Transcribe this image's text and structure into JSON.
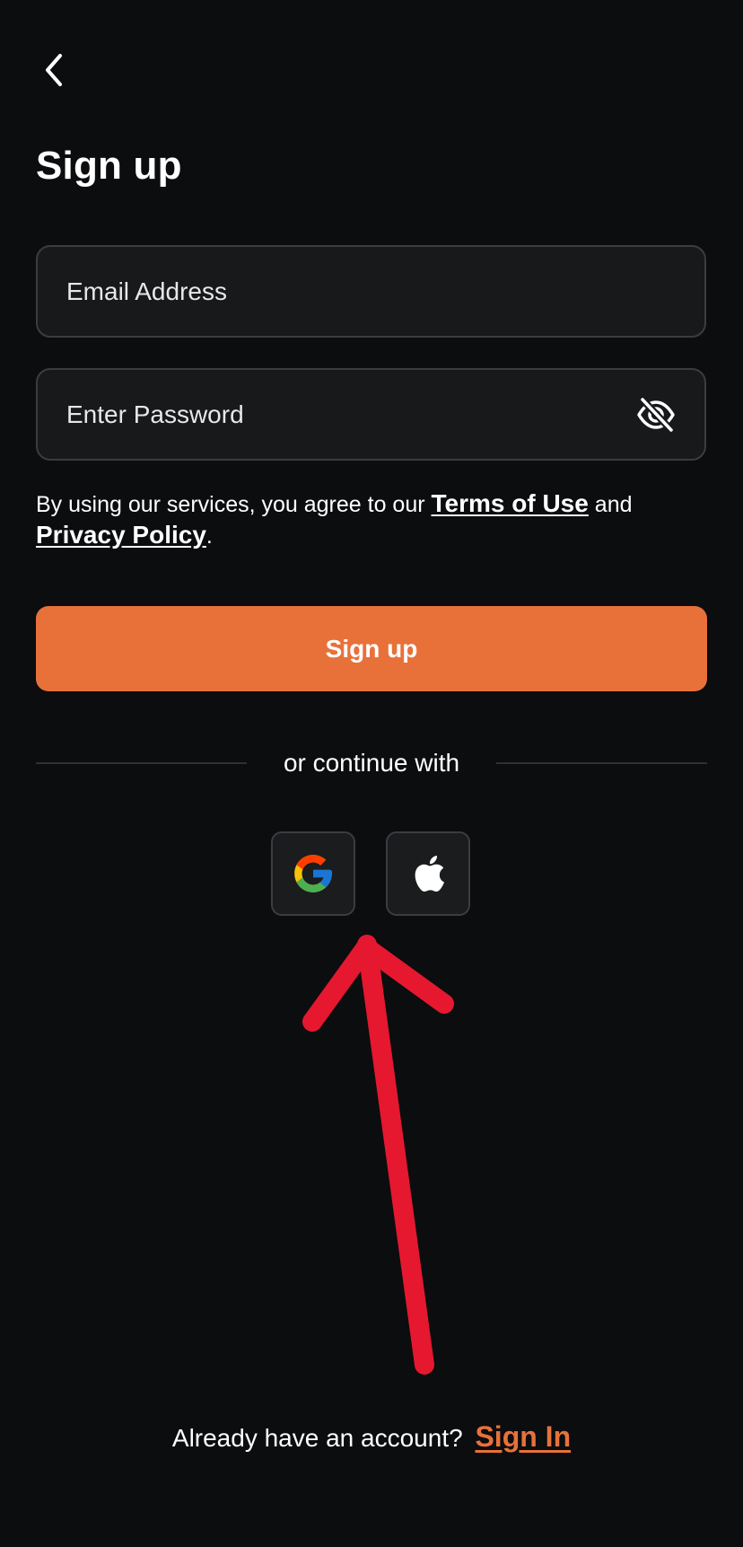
{
  "header": {
    "back_icon": "chevron-left-icon",
    "title": "Sign up"
  },
  "form": {
    "email": {
      "placeholder": "Email Address",
      "value": ""
    },
    "password": {
      "placeholder": "Enter Password",
      "value": "",
      "toggle_icon": "eye-off-icon"
    },
    "terms": {
      "prefix": "By using our services, you agree to our ",
      "terms_link": "Terms of Use",
      "middle": " and",
      "privacy_link": "Privacy Policy",
      "suffix": "."
    },
    "submit_label": "Sign up"
  },
  "social": {
    "divider_label": "or continue with",
    "providers": [
      {
        "name": "Google",
        "icon": "google-icon"
      },
      {
        "name": "Apple",
        "icon": "apple-icon"
      }
    ]
  },
  "annotation": {
    "type": "arrow",
    "color": "#e5182f",
    "points_to": "google-button"
  },
  "footer": {
    "prompt": "Already have an account?",
    "link": "Sign In"
  },
  "colors": {
    "background": "#0b0d0f",
    "accent": "#e8713a",
    "field_bg": "#17191b",
    "field_border": "#3a3d41"
  }
}
